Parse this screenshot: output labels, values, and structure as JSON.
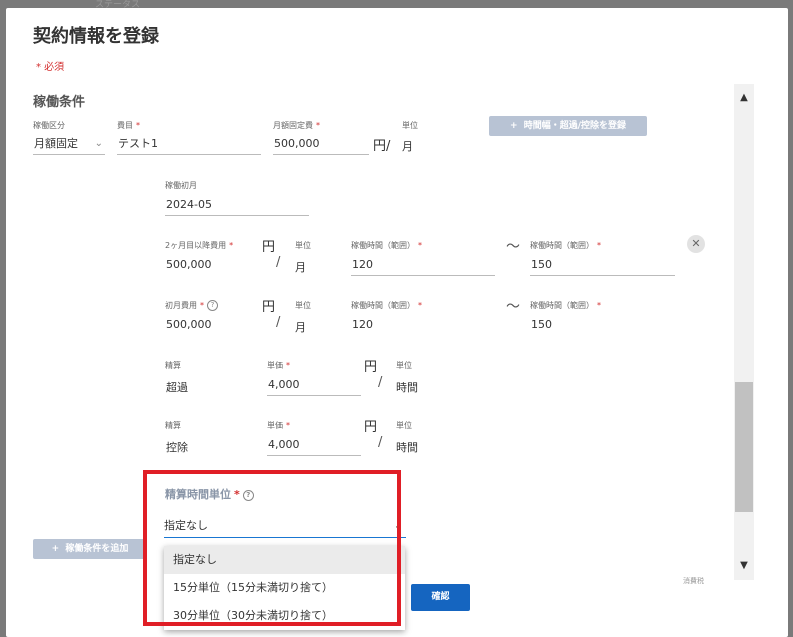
{
  "background": {
    "top_text": "ステータス",
    "right_text": "消費税"
  },
  "dialog": {
    "title": "契約情報を登録",
    "required_note": "* 必須",
    "section_title": "稼働条件",
    "required_mark": "*",
    "row1": {
      "kubun_label": "稼働区分",
      "kubun_value": "月額固定",
      "himoku_label": "費目",
      "himoku_value": "テスト1",
      "fixed_label": "月額固定費",
      "fixed_value": "500,000",
      "yen_slash": "円/",
      "unit_label": "単位",
      "unit_value": "月",
      "register_button": "時間幅・超過/控除を登録"
    },
    "start_month": {
      "label": "稼働初月",
      "value": "2024-05"
    },
    "second_month": {
      "label": "2ヶ月目以降費用",
      "value": "500,000",
      "yen": "円",
      "slash": "/",
      "unit_label": "単位",
      "unit_value": "月",
      "range_label_1": "稼働時間（範囲）",
      "range_value_1": "120",
      "tilde": "〜",
      "range_label_2": "稼働時間（範囲）",
      "range_value_2": "150"
    },
    "first_month": {
      "label": "初月費用",
      "value": "500,000",
      "yen": "円",
      "slash": "/",
      "unit_label": "単位",
      "unit_value": "月",
      "range_label_1": "稼働時間（範囲）",
      "range_value_1": "120",
      "tilde": "〜",
      "range_label_2": "稼働時間（範囲）",
      "range_value_2": "150"
    },
    "overtime": {
      "seisan_label": "精算",
      "seisan_value": "超過",
      "price_label": "単価",
      "price_value": "4,000",
      "yen": "円",
      "slash": "/",
      "unit_label": "単位",
      "unit_value": "時間"
    },
    "deduction": {
      "seisan_label": "精算",
      "seisan_value": "控除",
      "price_label": "単価",
      "price_value": "4,000",
      "yen": "円",
      "slash": "/",
      "unit_label": "単位",
      "unit_value": "時間"
    },
    "settlement_unit": {
      "label": "精算時間単位",
      "selected": "指定なし",
      "options": [
        "指定なし",
        "15分単位（15分未満切り捨て）",
        "30分単位（30分未満切り捨て）"
      ]
    },
    "add_condition_button": "稼働条件を追加",
    "confirm_button": "確認",
    "plus": "+"
  },
  "icons": {
    "close": "close-icon",
    "help": "help-icon",
    "chevron": "chevron-down-icon",
    "scroll_up": "triangle-up-icon",
    "scroll_down": "triangle-down-icon"
  },
  "colors": {
    "required": "#d32f2f",
    "primary": "#1565c0",
    "highlight": "#e01e26",
    "disabled_button": "#b8c3d4"
  }
}
